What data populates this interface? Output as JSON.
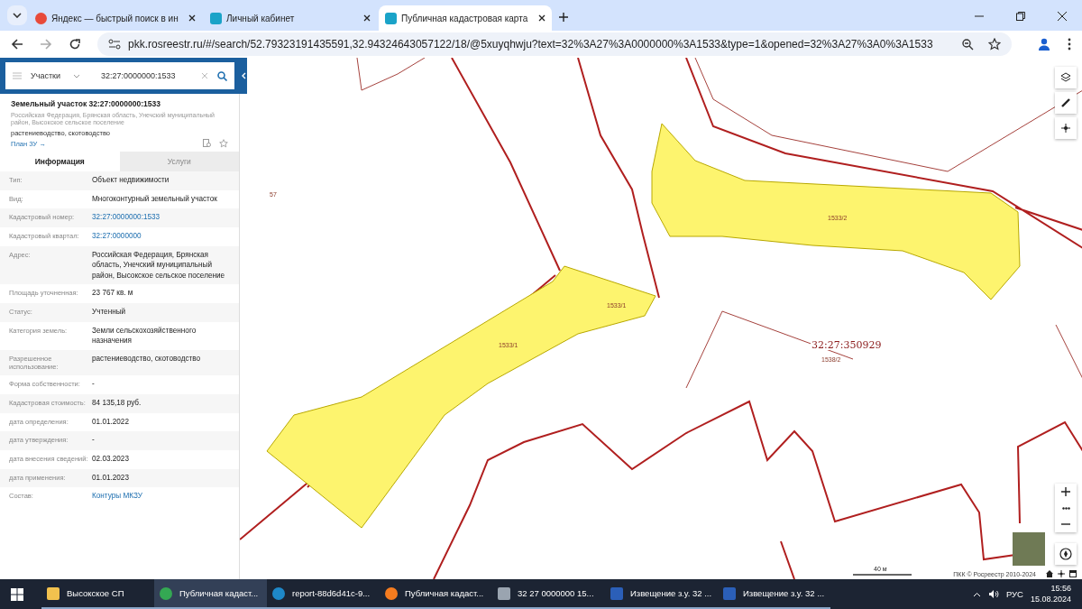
{
  "browser_tabs": [
    {
      "title": "Яндекс — быстрый поиск в ин",
      "selected": false
    },
    {
      "title": "Личный кабинет",
      "selected": false
    },
    {
      "title": "Публичная кадастровая карта",
      "selected": true
    }
  ],
  "address_bar": {
    "url": "pkk.rosreestr.ru/#/search/52.79323191435591,32.94324643057122/18/@5xuyqhwju?text=32%3A27%3A0000000%3A1533&type=1&opened=32%3A27%3A0%3A1533"
  },
  "search": {
    "category": "Участки",
    "value": "32:27:0000000:1533"
  },
  "object": {
    "title": "Земельный участок 32:27:0000000:1533",
    "address": "Российская Федерация, Брянская область, Унечский муниципальный район, Высокское сельское поселение",
    "usage": "растениеводство, скотоводство",
    "plan_link": "План ЗУ →"
  },
  "info_tabs": [
    {
      "label": "Информация",
      "selected": true
    },
    {
      "label": "Услуги",
      "selected": false
    }
  ],
  "info_rows": [
    {
      "label": "Тип:",
      "value": "Объект недвижимости",
      "kind": "text"
    },
    {
      "label": "Вид:",
      "value": "Многоконтурный земельный участок",
      "kind": "text"
    },
    {
      "label": "Кадастровый номер:",
      "value": "32:27:0000000:1533",
      "kind": "link"
    },
    {
      "label": "Кадастровый квартал:",
      "value": "32:27:0000000",
      "kind": "link"
    },
    {
      "label": "Адрес:",
      "value": "Российская Федерация, Брянская область, Унечский муниципальный район, Высокское сельское поселение",
      "kind": "text"
    },
    {
      "label": "Площадь уточненная:",
      "value": "23 767 кв. м",
      "kind": "text"
    },
    {
      "label": "Статус:",
      "value": "Учтенный",
      "kind": "text"
    },
    {
      "label": "Категория земель:",
      "value": "Земли сельскохозяйственного назначения",
      "kind": "text"
    },
    {
      "label": "Разрешенное использование:",
      "value": "растениеводство, скотоводство",
      "kind": "text"
    },
    {
      "label": "Форма собственности:",
      "value": "-",
      "kind": "text"
    },
    {
      "label": "Кадастровая стоимость:",
      "value": "84 135,18 руб.",
      "kind": "text"
    },
    {
      "label": "дата определения:",
      "value": "01.01.2022",
      "kind": "text"
    },
    {
      "label": "дата утверждения:",
      "value": "-",
      "kind": "text"
    },
    {
      "label": "дата внесения сведений:",
      "value": "02.03.2023",
      "kind": "text"
    },
    {
      "label": "дата применения:",
      "value": "01.01.2023",
      "kind": "text"
    },
    {
      "label": "Состав:",
      "value": "Контуры МКЗУ",
      "kind": "link"
    }
  ],
  "map_labels": [
    {
      "text": "57",
      "kind": "parcel"
    },
    {
      "text": "1533/2",
      "kind": "parcel"
    },
    {
      "text": "1533/1",
      "kind": "parcel"
    },
    {
      "text": "1533/1",
      "kind": "parcel"
    },
    {
      "text": "32:27:350929",
      "kind": "quarter"
    },
    {
      "text": "1538/2",
      "kind": "parcel"
    }
  ],
  "map": {
    "scale": "40 м",
    "attribution": "ПКК © Росреестр 2010-2024"
  },
  "taskbar": [
    {
      "label": "Высокское СП",
      "selected": false
    },
    {
      "label": "Публичная кадаст...",
      "selected": true
    },
    {
      "label": "report-88d6d41c-9...",
      "selected": false
    },
    {
      "label": "Публичная кадаст...",
      "selected": false
    },
    {
      "label": "32  27  0000000  15...",
      "selected": false
    },
    {
      "label": "Извещение з.у. 32 ...",
      "selected": false
    },
    {
      "label": "Извещение з.у. 32 ...",
      "selected": false
    }
  ],
  "tray": {
    "language": "РУС",
    "time": "15:56",
    "date": "15.08.2024"
  }
}
